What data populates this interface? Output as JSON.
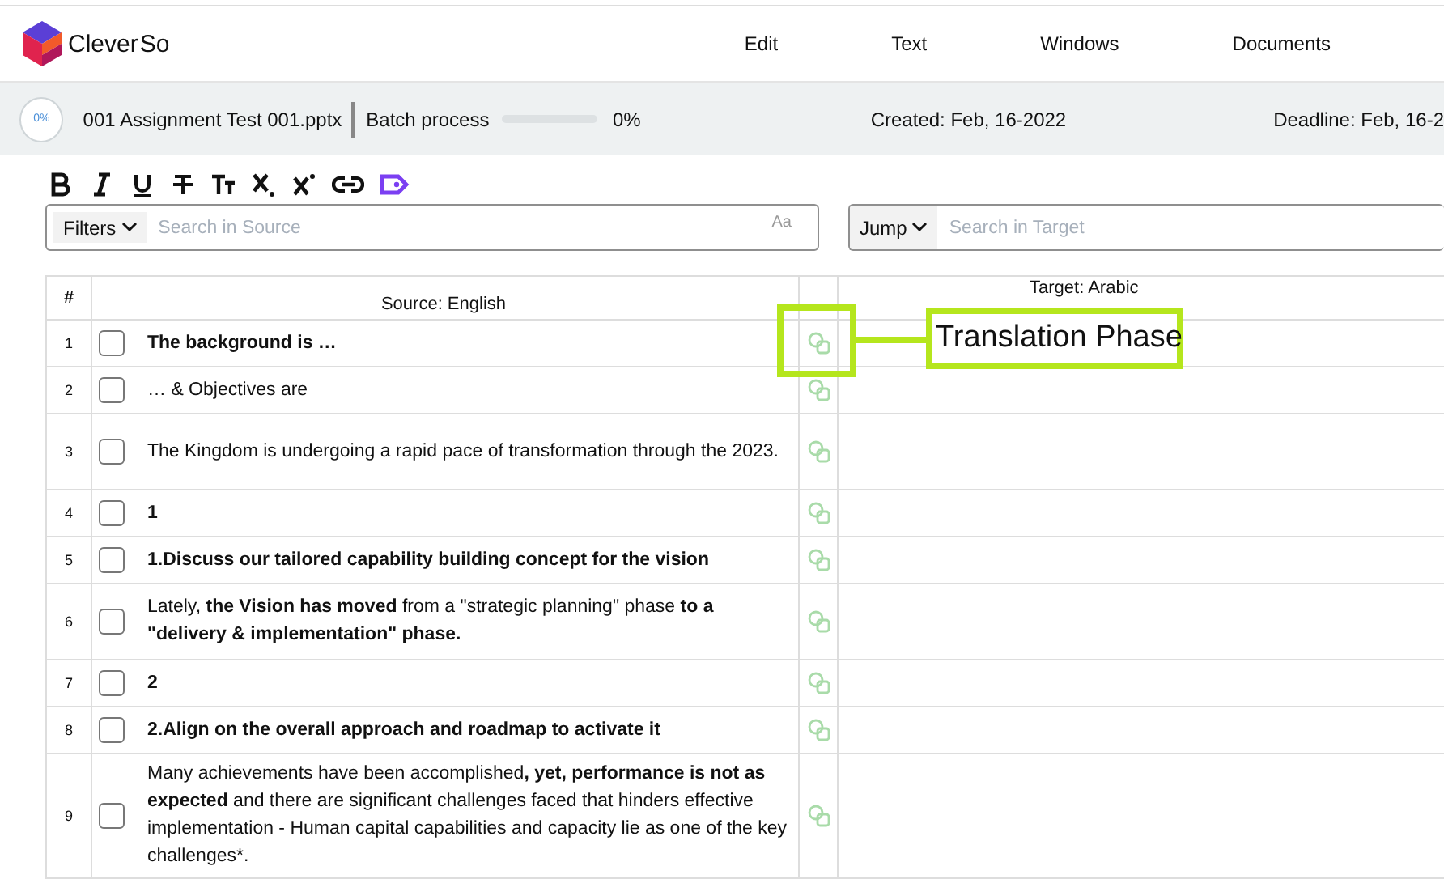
{
  "header": {
    "brand": {
      "name": "Clever",
      "suffix": "So"
    },
    "menu": [
      "Edit",
      "Text",
      "Windows",
      "Documents"
    ]
  },
  "info_bar": {
    "progress_ring": "0%",
    "file_name": "001 Assignment Test 001.pptx",
    "batch_label": "Batch process",
    "batch": {
      "level": 0
    },
    "batch_reading": "0%",
    "created": "Created: Feb, 16-2022",
    "deadline": "Deadline: Feb, 16-2"
  },
  "format_toolbar": [
    {
      "kind": "bold"
    },
    {
      "kind": "italic"
    },
    {
      "kind": "underline"
    },
    {
      "kind": "strikethrough"
    },
    {
      "kind": "text-size"
    },
    {
      "kind": "subscript"
    },
    {
      "kind": "superscript"
    },
    {
      "kind": "link"
    },
    {
      "kind": "tag"
    }
  ],
  "source_search": {
    "filter_label": "Filters",
    "placeholder": "Search in Source",
    "case_toggle": "Aa"
  },
  "target_search": {
    "filter_label": "Jump",
    "placeholder": "Search in Target"
  },
  "table": {
    "columns": [
      "#",
      "Source: English",
      "Target: Arabic"
    ],
    "rows": [
      {
        "number": "1",
        "checked": false,
        "bold": true,
        "source": "The background is …"
      },
      {
        "number": "2",
        "checked": false,
        "bold": false,
        "source": "… & Objectives are"
      },
      {
        "number": "3",
        "checked": false,
        "bold": false,
        "source": "The Kingdom is undergoing a rapid pace of transformation through the 2023."
      },
      {
        "number": "4",
        "checked": false,
        "bold": true,
        "source": "1"
      },
      {
        "number": "5",
        "checked": false,
        "bold": true,
        "source": "1.Discuss our tailored capability building concept for the vision"
      },
      {
        "number": "6",
        "checked": false,
        "bold": false,
        "source": "Lately, **the Vision has moved** from a \"strategic planning\" phase **to a \"delivery & implementation\" phase.**"
      },
      {
        "number": "7",
        "checked": false,
        "bold": true,
        "source": "2"
      },
      {
        "number": "8",
        "checked": false,
        "bold": true,
        "source": "2.Align on the overall approach and roadmap to activate it"
      },
      {
        "number": "9",
        "checked": false,
        "bold": false,
        "source": "Many achievements have been accomplished**, yet, performance is not as expected** and there are significant challenges faced that hinders effective implementation - Human capital capabilities and capacity lie as one of the key challenges*."
      }
    ]
  },
  "annotation": {
    "label": "Translation Phase"
  }
}
